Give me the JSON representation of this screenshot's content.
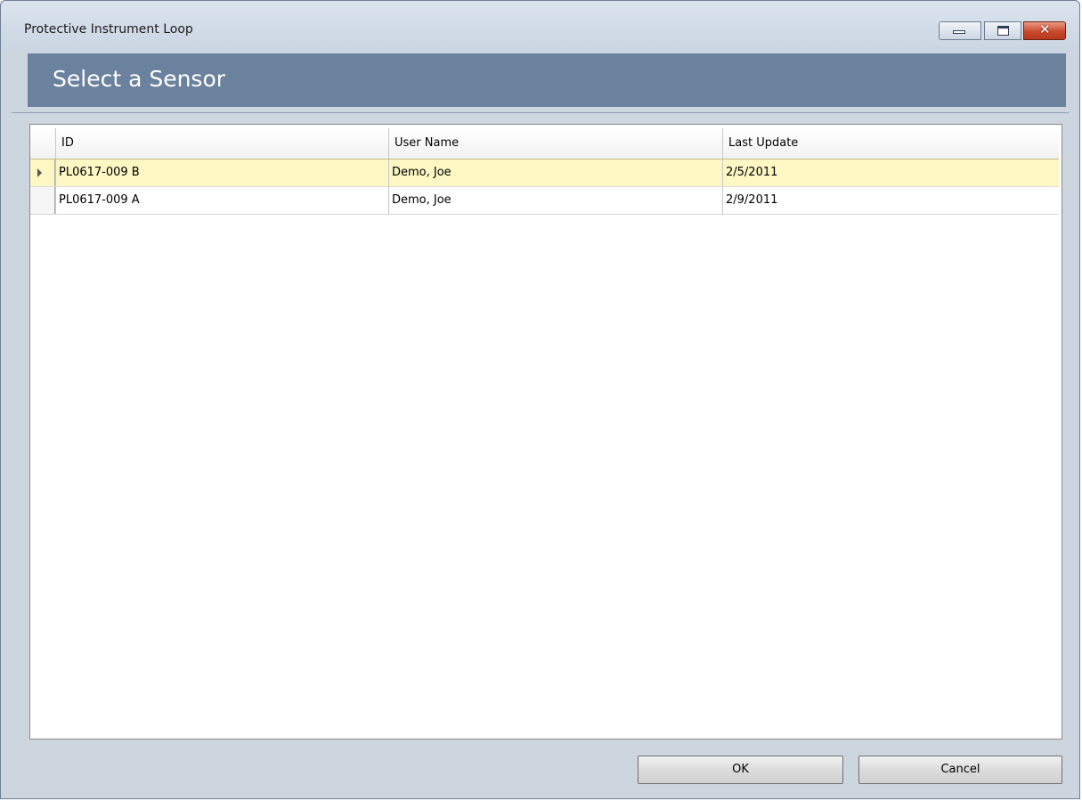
{
  "window": {
    "title": "Protective Instrument Loop",
    "controls": {
      "minimize_icon": "minimize-icon",
      "maximize_icon": "maximize-icon",
      "close_icon": "close-icon",
      "close_glyph": "✕"
    }
  },
  "header": {
    "title": "Select a Sensor"
  },
  "grid": {
    "columns": [
      "ID",
      "User Name",
      "Last Update"
    ],
    "rows": [
      {
        "id": "PL0617-009 B",
        "user_name": "Demo, Joe",
        "last_update": "2/5/2011",
        "selected": true
      },
      {
        "id": "PL0617-009 A",
        "user_name": "Demo, Joe",
        "last_update": "2/9/2011",
        "selected": false
      }
    ]
  },
  "buttons": {
    "ok_label": "OK",
    "cancel_label": "Cancel"
  },
  "colors": {
    "banner": "#6b829e",
    "selected_row": "#fdf7c3",
    "window_bg": "#cdd5de"
  }
}
